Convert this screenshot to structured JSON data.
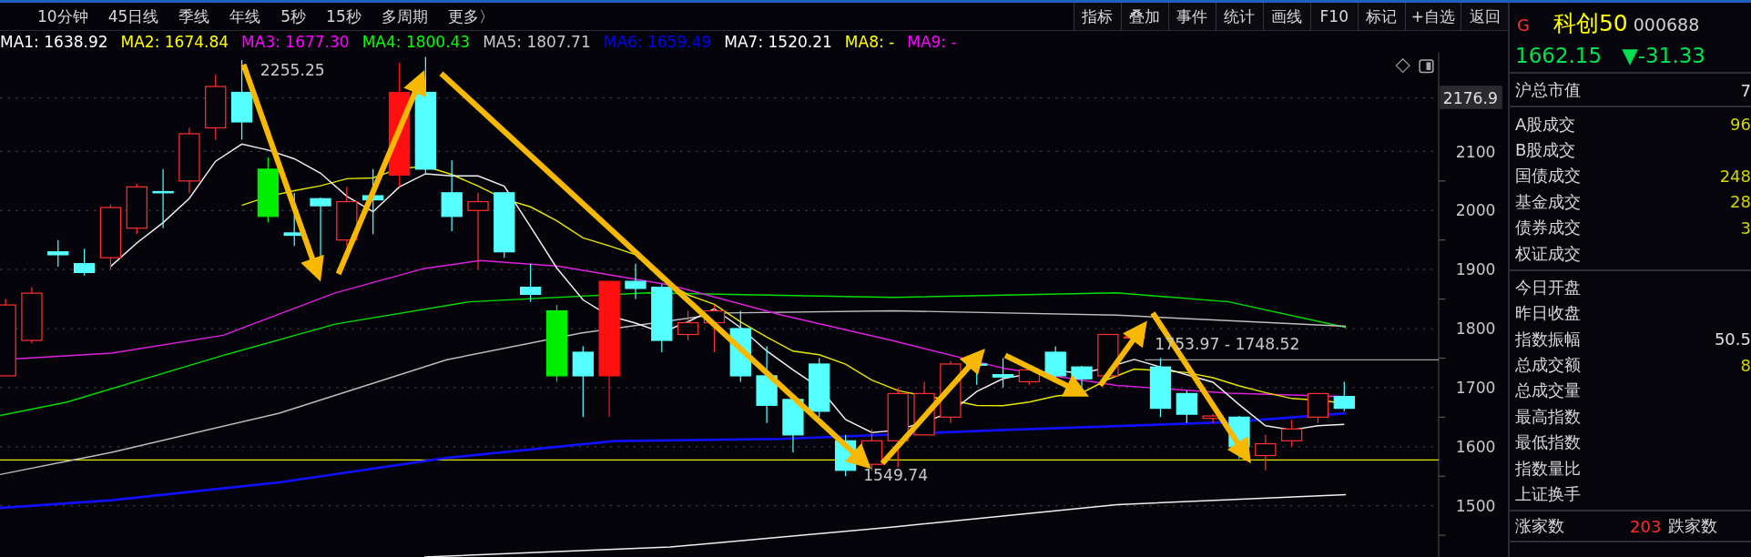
{
  "period_tabs": [
    {
      "label": "10分钟"
    },
    {
      "label": "45日线"
    },
    {
      "label": "季线"
    },
    {
      "label": "年线"
    },
    {
      "label": "5秒"
    },
    {
      "label": "15秒"
    },
    {
      "label": "多周期"
    },
    {
      "label": "更多〉"
    }
  ],
  "toolbar_buttons": [
    "指标",
    "叠加",
    "事件",
    "统计",
    "画线",
    "F10",
    "标记",
    "+自选",
    "返回"
  ],
  "ma_legend": [
    {
      "label": "MA1: 1638.92",
      "color": "#ffffff"
    },
    {
      "label": "MA2: 1674.84",
      "color": "#ffff00"
    },
    {
      "label": "MA3: 1677.30",
      "color": "#ff00ff"
    },
    {
      "label": "MA4: 1800.43",
      "color": "#00ff00"
    },
    {
      "label": "MA5: 1807.71",
      "color": "#c8c8c8"
    },
    {
      "label": "MA6: 1659.49",
      "color": "#0000ff"
    },
    {
      "label": "MA7: 1520.21",
      "color": "#ffffff"
    },
    {
      "label": "MA8: -",
      "color": "#ffff00"
    },
    {
      "label": "MA9: -",
      "color": "#ff00ff"
    }
  ],
  "chart": {
    "y_axis_labels": [
      "2100",
      "2000",
      "1900",
      "1800",
      "1700",
      "1600",
      "1500"
    ],
    "cursor_price": "2176.9",
    "high_label": "2255.25",
    "low_label": "1549.74",
    "range_label": "1753.97 - 1748.52"
  },
  "quote": {
    "flag": "G",
    "name": "科创50",
    "code": "000688",
    "price": "1662.15",
    "change": "▼-31.33"
  },
  "stat_groups": [
    [
      {
        "label": "沪总市值",
        "value": "7",
        "color": "#e0e0e0"
      }
    ],
    [
      {
        "label": "A股成交",
        "value": "96",
        "color": "#d4d400"
      },
      {
        "label": "B股成交"
      },
      {
        "label": "国债成交",
        "value": "248",
        "color": "#d4d400"
      },
      {
        "label": "基金成交",
        "value": "28",
        "color": "#d4d400"
      },
      {
        "label": "债券成交",
        "value": "3",
        "color": "#d4d400"
      },
      {
        "label": "权证成交"
      }
    ],
    [
      {
        "label": "今日开盘"
      },
      {
        "label": "昨日收盘"
      },
      {
        "label": "指数振幅",
        "value": "50.5",
        "color": "#e0e0e0"
      },
      {
        "label": "总成交额",
        "value": "8",
        "color": "#d4d400"
      },
      {
        "label": "总成交量"
      },
      {
        "label": "最高指数"
      },
      {
        "label": "最低指数"
      },
      {
        "label": "指数量比"
      },
      {
        "label": "上证换手"
      }
    ]
  ],
  "breadth": {
    "up_label": "涨家数",
    "up_count": "203",
    "down_label": "跌家数"
  }
}
